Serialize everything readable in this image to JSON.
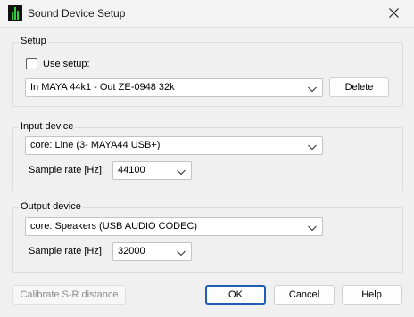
{
  "window": {
    "title": "Sound Device Setup",
    "icon": "app-icon",
    "close_icon": "close-icon"
  },
  "setup": {
    "group_label": "Setup",
    "use_setup_label": "Use setup:",
    "use_setup_checked": false,
    "selected": "In MAYA 44k1 - Out ZE-0948 32k",
    "delete_label": "Delete"
  },
  "input": {
    "group_label": "Input device",
    "device": "core: Line (3- MAYA44 USB+)",
    "sample_rate_label": "Sample rate [Hz]:",
    "sample_rate": "44100"
  },
  "output": {
    "group_label": "Output device",
    "device": "core: Speakers (USB AUDIO  CODEC)",
    "sample_rate_label": "Sample rate [Hz]:",
    "sample_rate": "32000"
  },
  "footer": {
    "calibrate_label": "Calibrate S-R distance",
    "ok_label": "OK",
    "cancel_label": "Cancel",
    "help_label": "Help"
  }
}
